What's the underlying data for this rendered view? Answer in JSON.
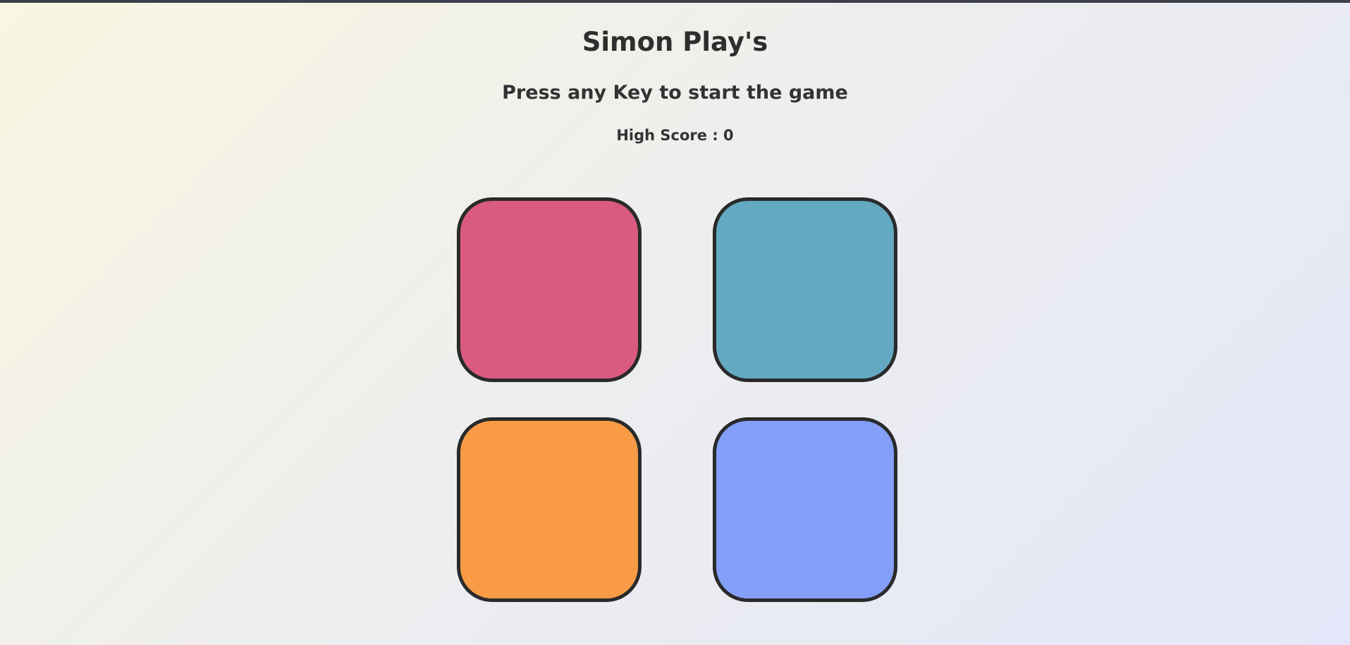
{
  "game": {
    "title": "Simon Play's",
    "instruction": "Press any Key to start the game",
    "high_score_text": "High Score : 0",
    "high_score": 0
  },
  "buttons": [
    {
      "id": "red",
      "color": "#da5a80"
    },
    {
      "id": "green",
      "color": "#63a9c1"
    },
    {
      "id": "yellow",
      "color": "#f99b46"
    },
    {
      "id": "purple",
      "color": "#839ff8"
    }
  ],
  "colors": {
    "top_bar": "#3d3f4a",
    "pad_border": "#2a2a2a",
    "text": "#333333"
  }
}
